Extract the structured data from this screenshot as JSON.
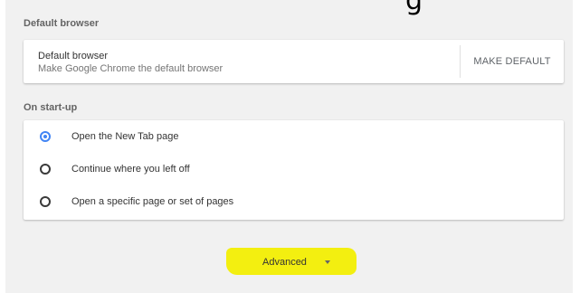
{
  "top_glyph": "g",
  "sections": {
    "default_browser": {
      "title": "Default browser",
      "card_title": "Default browser",
      "card_subtitle": "Make Google Chrome the default browser",
      "button": "MAKE DEFAULT"
    },
    "startup": {
      "title": "On start-up",
      "options": [
        {
          "label": "Open the New Tab page",
          "selected": true
        },
        {
          "label": "Continue where you left off",
          "selected": false
        },
        {
          "label": "Open a specific page or set of pages",
          "selected": false
        }
      ]
    }
  },
  "advanced": {
    "label": "Advanced",
    "icon": "dropdown-arrow-icon",
    "highlight_color": "#f3ef10"
  },
  "colors": {
    "accent": "#4285f4",
    "page_background": "#f1f1f1"
  }
}
